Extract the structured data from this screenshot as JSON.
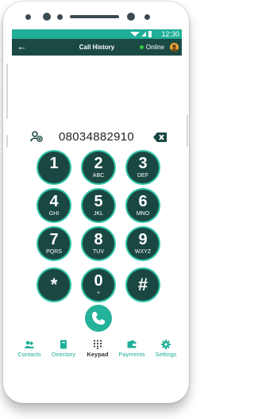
{
  "status_bar": {
    "time": "12:30"
  },
  "header": {
    "back_icon": "arrow-left-icon",
    "title": "Call History",
    "presence": "Online"
  },
  "dialer": {
    "number": "08034882910"
  },
  "keypad": {
    "keys": [
      {
        "digit": "1",
        "letters": ""
      },
      {
        "digit": "2",
        "letters": "ABC"
      },
      {
        "digit": "3",
        "letters": "DEF"
      },
      {
        "digit": "4",
        "letters": "GHI"
      },
      {
        "digit": "5",
        "letters": "JKL"
      },
      {
        "digit": "6",
        "letters": "MNO"
      },
      {
        "digit": "7",
        "letters": "PQRS"
      },
      {
        "digit": "8",
        "letters": "TUV"
      },
      {
        "digit": "9",
        "letters": "WXYZ"
      },
      {
        "digit": "*",
        "letters": ""
      },
      {
        "digit": "0",
        "letters": "+"
      },
      {
        "digit": "#",
        "letters": ""
      }
    ]
  },
  "bottom_nav": {
    "active": "Keypad",
    "items": [
      {
        "label": "Contacts",
        "icon": "contacts-icon"
      },
      {
        "label": "Directory",
        "icon": "book-icon"
      },
      {
        "label": "Keypad",
        "icon": "keypad-icon"
      },
      {
        "label": "Payments",
        "icon": "wallet-icon"
      },
      {
        "label": "Settings",
        "icon": "gear-icon"
      }
    ]
  },
  "colors": {
    "accent": "#1fae98",
    "key_fill": "#1a4742",
    "key_ring": "#2ec4a6",
    "header": "#1b4a44"
  }
}
